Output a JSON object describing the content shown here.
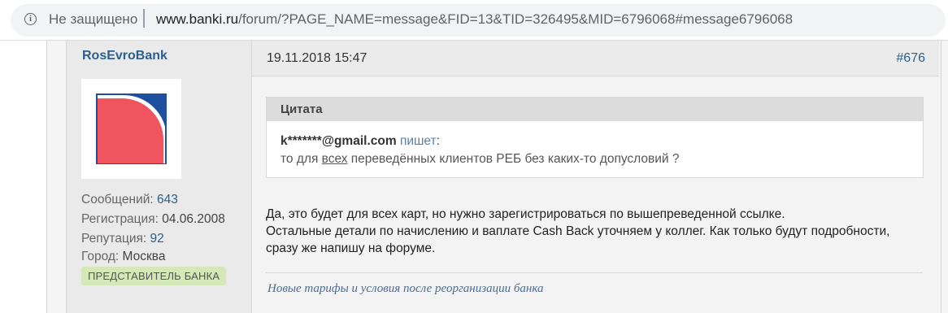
{
  "browser": {
    "security_label": "Не защищено",
    "url_host": "www.banki.ru",
    "url_rest": "/forum/?PAGE_NAME=message&FID=13&TID=326495&MID=6796068#message6796068"
  },
  "post": {
    "author": "RosEvroBank",
    "stats": {
      "messages_label": "Сообщений:",
      "messages_value": "643",
      "registration_label": "Регистрация:",
      "registration_value": "04.06.2008",
      "reputation_label": "Репутация:",
      "reputation_value": "92",
      "city_label": "Город:",
      "city_value": "Москва"
    },
    "badge": "ПРЕДСТАВИТЕЛЬ БАНКА",
    "date": "19.11.2018 15:47",
    "number": "#676",
    "quote": {
      "title": "Цитата",
      "author": "k*******@gmail.com",
      "writes": "пишет",
      "text_before": "то для ",
      "text_underlined": "всех",
      "text_after": " переведённых клиентов РЕБ без каких-то допусловий ?"
    },
    "body_lines": [
      "Да, это будет для всех карт, но нужно зарегистрироваться по вышепреведенной ссылке.",
      "Остальные детали по начислению и ваплате Cash Back уточняем у коллег. Как только будут подробности,",
      "сразу же напишу на форуме."
    ],
    "signature": "Новые тарифы и условия после реорганизации банка"
  },
  "colors": {
    "link": "#2c5f8d",
    "badge_bg": "#d4e8b8",
    "logo_red": "#f0545f",
    "logo_blue": "#1e4fa0"
  }
}
